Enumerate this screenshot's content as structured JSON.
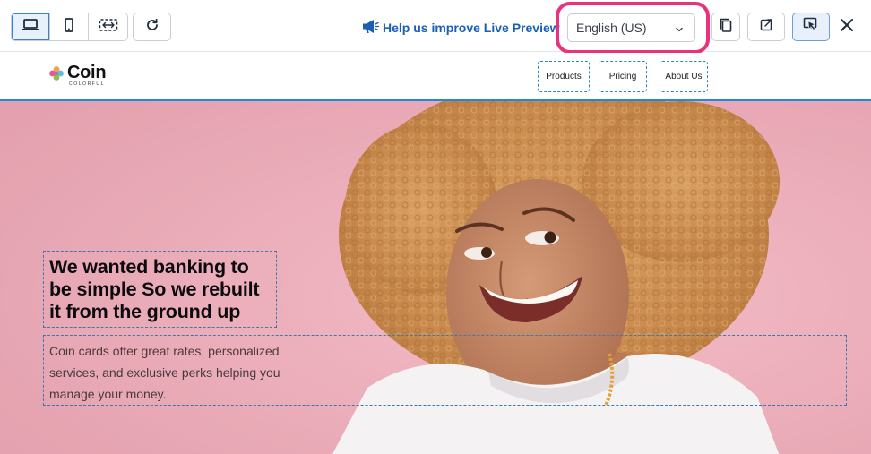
{
  "toolbar": {
    "device_buttons": [
      {
        "icon": "laptop-icon",
        "active": true
      },
      {
        "icon": "mobile-icon",
        "active": false
      },
      {
        "icon": "resize-width-icon",
        "active": false
      }
    ],
    "refresh_icon": "refresh-icon",
    "help_link": "Help us improve Live Preview",
    "help_icon": "megaphone-icon",
    "language": {
      "selected": "English (US)"
    },
    "copy_icon": "copy-icon",
    "open_external_icon": "external-link-icon",
    "select_mode_icon": "cursor-select-icon",
    "close_icon": "close-icon",
    "highlight_color": "#e8327d",
    "accent_color": "#1a5fb4"
  },
  "site": {
    "logo": {
      "name": "Coin",
      "tagline": "COLORFUL"
    },
    "nav": [
      {
        "label": "Products"
      },
      {
        "label": "Pricing"
      },
      {
        "label": "About Us"
      }
    ],
    "hero": {
      "title": "We wanted banking to be simple So we rebuilt it from the ground up",
      "description": "Coin cards offer great rates, personalized services, and exclusive perks helping you manage your money.",
      "background_color": "#e6a8b5"
    }
  }
}
